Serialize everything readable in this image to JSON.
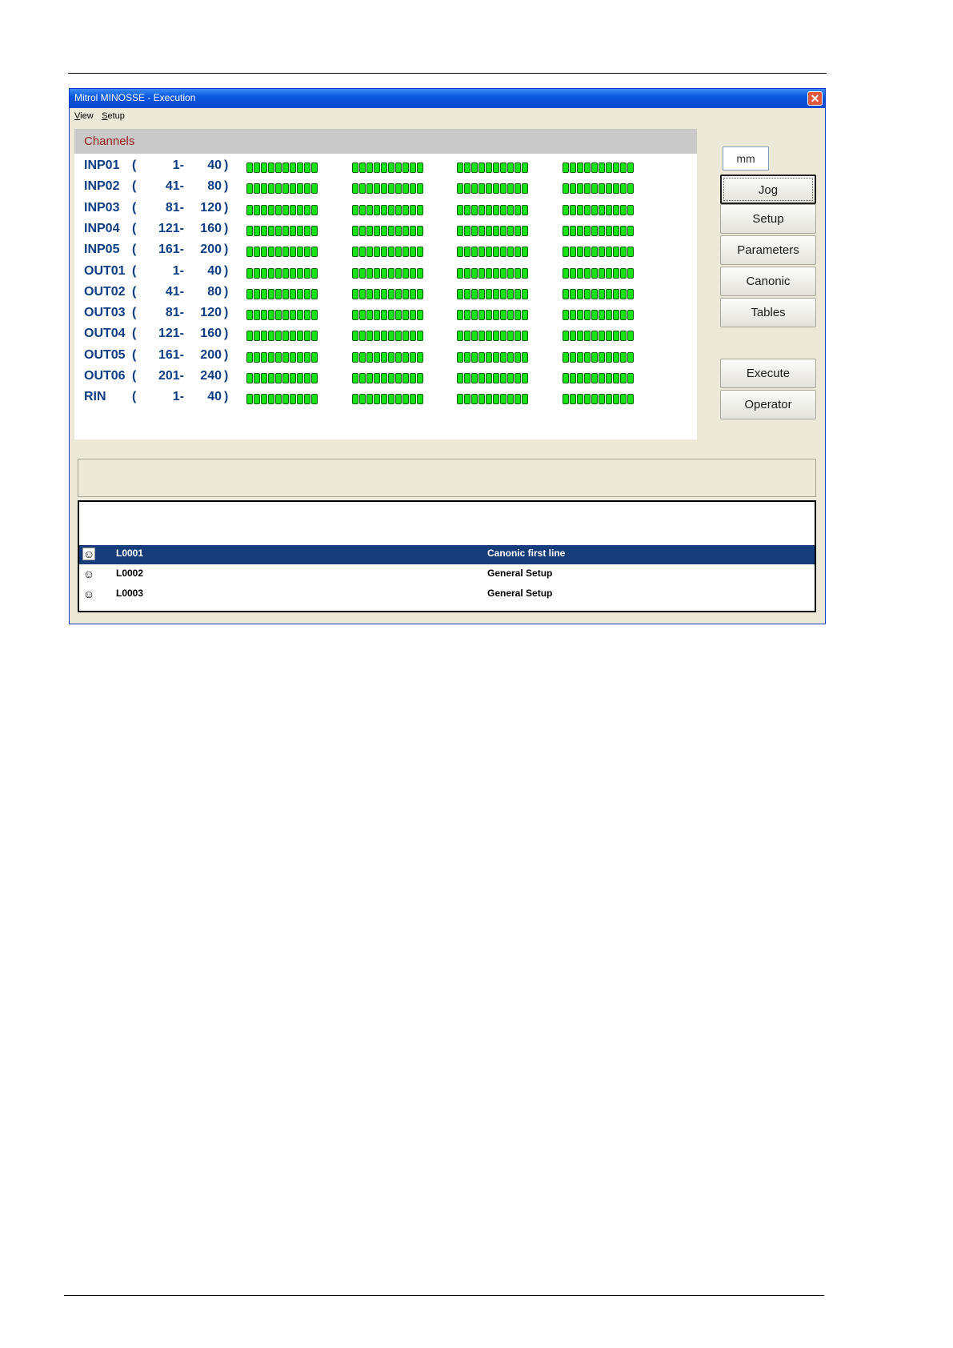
{
  "window": {
    "title": "Mitrol MINOSSE - Execution",
    "close_icon": "close-icon"
  },
  "menu": [
    "View",
    "Setup"
  ],
  "channels": {
    "header": "Channels",
    "leds_per_group": 10,
    "groups_per_row": 4,
    "led_color": "#17e317",
    "rows": [
      {
        "name": "INP01",
        "paren": "(",
        "from": "1-",
        "to": "40",
        "close": ")"
      },
      {
        "name": "INP02",
        "paren": "(",
        "from": "41-",
        "to": "80",
        "close": ")"
      },
      {
        "name": "INP03",
        "paren": "(",
        "from": "81-",
        "to": "120",
        "close": ")"
      },
      {
        "name": "INP04",
        "paren": "(",
        "from": "121-",
        "to": "160",
        "close": ")"
      },
      {
        "name": "INP05",
        "paren": "(",
        "from": "161-",
        "to": "200",
        "close": ")"
      },
      {
        "name": "OUT01",
        "paren": "(",
        "from": "1-",
        "to": "40",
        "close": ")"
      },
      {
        "name": "OUT02",
        "paren": "(",
        "from": "41-",
        "to": "80",
        "close": ")"
      },
      {
        "name": "OUT03",
        "paren": "(",
        "from": "81-",
        "to": "120",
        "close": ")"
      },
      {
        "name": "OUT04",
        "paren": "(",
        "from": "121-",
        "to": "160",
        "close": ")"
      },
      {
        "name": "OUT05",
        "paren": "(",
        "from": "161-",
        "to": "200",
        "close": ")"
      },
      {
        "name": "OUT06",
        "paren": "(",
        "from": "201-",
        "to": "240",
        "close": ")"
      },
      {
        "name": "RIN",
        "paren": "(",
        "from": "1-",
        "to": "40",
        "close": ")"
      }
    ]
  },
  "unit": "mm",
  "buttons": {
    "jog": "Jog",
    "setup": "Setup",
    "parameters": "Parameters",
    "canonic": "Canonic",
    "tables": "Tables",
    "execute": "Execute",
    "operator": "Operator"
  },
  "status_text": "",
  "program_lines": [
    {
      "icon": "smiley-icon",
      "code": "L0001",
      "desc": "Canonic first line",
      "selected": true
    },
    {
      "icon": "smiley-icon",
      "code": "L0002",
      "desc": "General Setup",
      "selected": false
    },
    {
      "icon": "smiley-icon",
      "code": "L0003",
      "desc": "General Setup",
      "selected": false
    }
  ],
  "colors": {
    "title_bar": "#0a58e0",
    "selection": "#173c7a",
    "channel_label": "#0f3e84",
    "channels_header_text": "#9b1c1c"
  }
}
